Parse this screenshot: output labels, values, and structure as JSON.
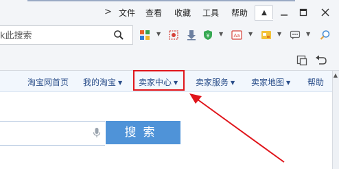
{
  "menubar": {
    "overflow_arrow": ">",
    "items": [
      "文件",
      "查看",
      "收藏",
      "工具",
      "帮助"
    ],
    "window_controls": {
      "pin": "pin-icon",
      "minimize": "minimize-icon",
      "maximize": "maximize-icon",
      "close": "close-icon"
    }
  },
  "toolbar": {
    "search_value": "k此搜索",
    "search_icon": "search-icon",
    "icons": [
      "apps-grid-icon",
      "screenshot-icon",
      "download-icon",
      "shield-yen-icon",
      "translate-icon",
      "extensions-icon",
      "feedback-icon",
      "find-icon"
    ]
  },
  "secondary_toolbar": {
    "icons": [
      "restore-window-icon",
      "back-arrow-icon"
    ]
  },
  "site_nav": {
    "items": [
      {
        "label": "淘宝网首页",
        "has_caret": false
      },
      {
        "label": "我的淘宝",
        "has_caret": true
      },
      {
        "label": "卖家中心",
        "has_caret": true,
        "highlighted": true
      },
      {
        "label": "卖家服务",
        "has_caret": true
      },
      {
        "label": "卖家地图",
        "has_caret": true
      },
      {
        "label": "帮助",
        "has_caret": false
      }
    ],
    "caret": "▼",
    "highlight_color": "#e0151b"
  },
  "page_search": {
    "button_label": "搜索",
    "mic_icon": "microphone-icon",
    "button_color": "#4f93d8"
  },
  "annotation": {
    "arrow_color": "#e0151b"
  }
}
